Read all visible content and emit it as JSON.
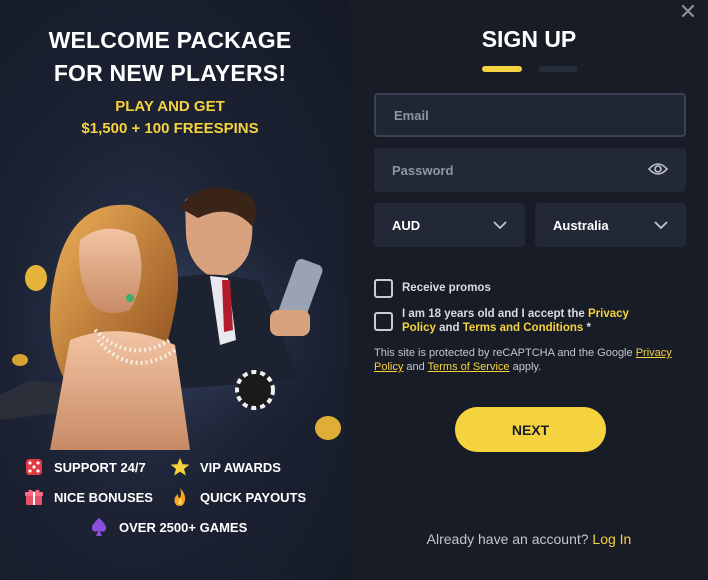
{
  "promo": {
    "title_line1": "WELCOME PACKAGE",
    "title_line2": "FOR NEW PLAYERS!",
    "sub_line1": "PLAY AND GET",
    "sub_line2": "$1,500 + 100 FREESPINS",
    "features": [
      {
        "label": "SUPPORT 24/7",
        "icon": "dice-icon"
      },
      {
        "label": "VIP AWARDS",
        "icon": "star-icon"
      },
      {
        "label": "NICE BONUSES",
        "icon": "gift-icon"
      },
      {
        "label": "QUICK PAYOUTS",
        "icon": "flame-icon"
      },
      {
        "label": "OVER 2500+ GAMES",
        "icon": "spade-icon"
      }
    ]
  },
  "form": {
    "close_glyph": "✕",
    "title": "SIGN UP",
    "steps": {
      "current": 1,
      "total": 2
    },
    "email_placeholder": "Email",
    "password_placeholder": "Password",
    "currency_value": "AUD",
    "country_value": "Australia",
    "promos_label": "Receive promos",
    "age_text_1": "I am 18 years old and I accept the ",
    "privacy_policy_link": "Privacy Policy",
    "and_text": " and ",
    "terms_link": "Terms and Conditions",
    "required_mark": " *",
    "recaptcha_text_1": "This site is protected by reCAPTCHA and the Google ",
    "recaptcha_privacy": "Privacy Policy",
    "recaptcha_and": " and ",
    "recaptcha_terms": "Terms of Service",
    "recaptcha_text_2": " apply.",
    "next_label": "NEXT",
    "login_prompt": "Already have an account? ",
    "login_link": "Log In"
  },
  "colors": {
    "accent": "#f5d33f",
    "panel_bg": "#181c26",
    "field_bg": "#222836"
  }
}
